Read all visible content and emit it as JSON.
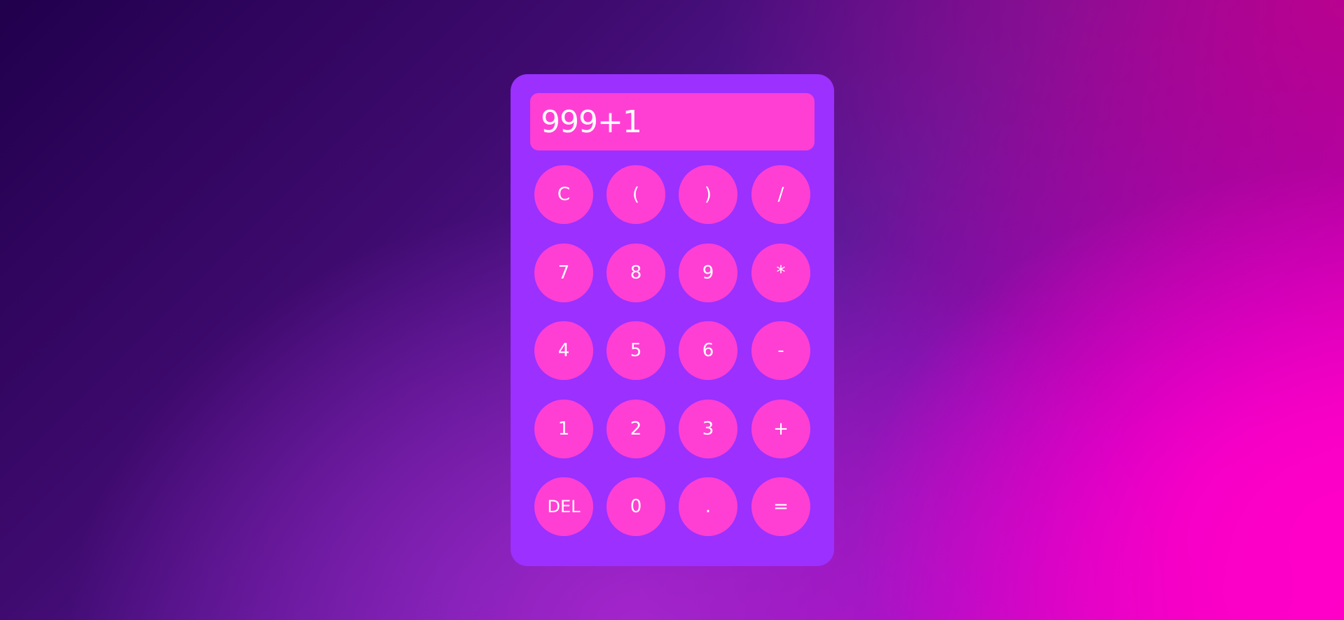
{
  "display": {
    "value": "999+1"
  },
  "keys": {
    "clear": "C",
    "open_paren": "(",
    "close_paren": ")",
    "divide": "/",
    "seven": "7",
    "eight": "8",
    "nine": "9",
    "multiply": "*",
    "four": "4",
    "five": "5",
    "six": "6",
    "subtract": "-",
    "one": "1",
    "two": "2",
    "three": "3",
    "add": "+",
    "delete": "DEL",
    "zero": "0",
    "decimal": ".",
    "equals": "="
  },
  "colors": {
    "calculator_body": "#9b30ff",
    "key_background": "#ff3fd3",
    "text": "#ffffff"
  }
}
